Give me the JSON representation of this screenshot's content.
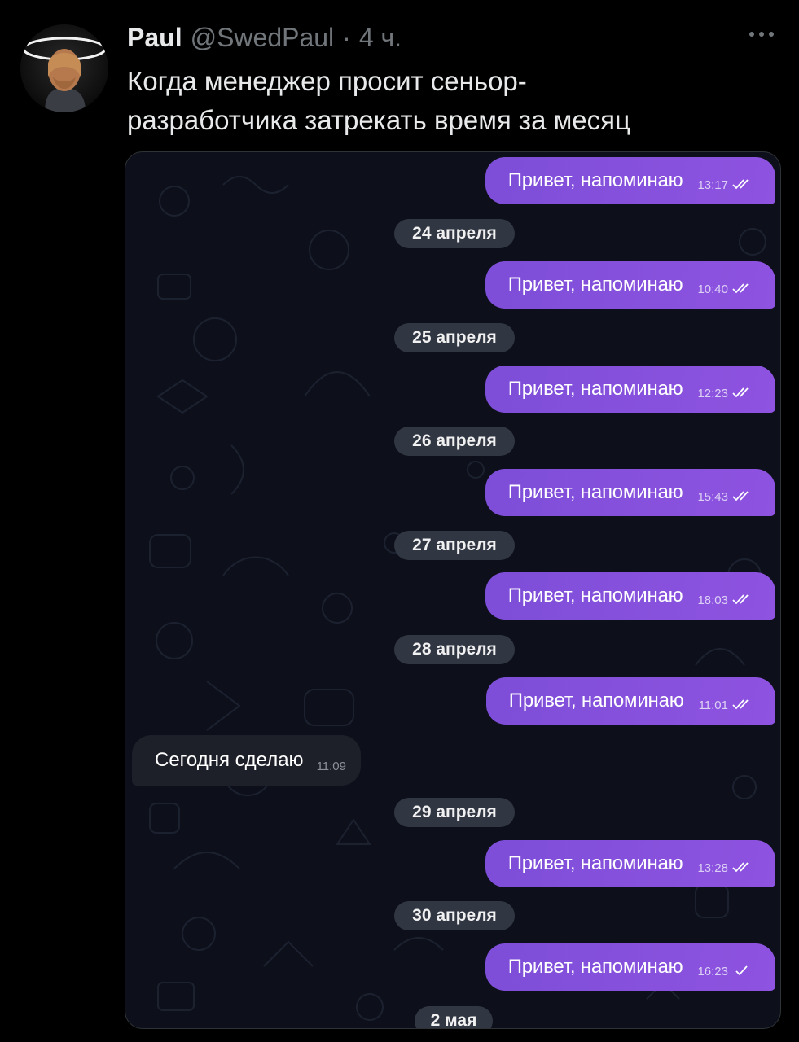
{
  "tweet": {
    "author_name": "Paul",
    "author_handle": "@SwedPaul",
    "separator": "·",
    "age": "4 ч.",
    "text": "Когда менеджер просит сеньор-\nразработчика затрекать время за месяц",
    "more_icon": "more-horizontal-icon",
    "avatar_icon": "avatar-with-halo"
  },
  "chat": {
    "colors": {
      "outgoing_bubble": "#8a52e0",
      "incoming_bubble": "#1d2029",
      "date_chip": "#343946",
      "background": "#0d101b"
    },
    "outgoing": [
      {
        "text": "Привет, напоминаю",
        "time": "13:17",
        "status": "read"
      },
      {
        "text": "Привет, напоминаю",
        "time": "10:40",
        "status": "read"
      },
      {
        "text": "Привет, напоминаю",
        "time": "12:23",
        "status": "read"
      },
      {
        "text": "Привет, напоминаю",
        "time": "15:43",
        "status": "read"
      },
      {
        "text": "Привет, напоминаю",
        "time": "18:03",
        "status": "read"
      },
      {
        "text": "Привет, напоминаю",
        "time": "11:01",
        "status": "read"
      },
      {
        "text": "Привет, напоминаю",
        "time": "13:28",
        "status": "read"
      },
      {
        "text": "Привет, напоминаю",
        "time": "16:23",
        "status": "sent"
      }
    ],
    "dates": [
      "24 апреля",
      "25 апреля",
      "26 апреля",
      "27 апреля",
      "28 апреля",
      "29 апреля",
      "30 апреля",
      "2 мая"
    ],
    "incoming": [
      {
        "text": "Сегодня сделаю",
        "time": "11:09"
      }
    ]
  }
}
